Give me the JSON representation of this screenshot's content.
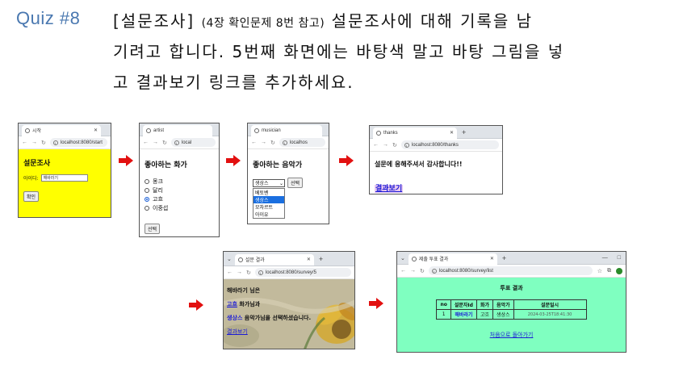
{
  "header": {
    "quiz_label": "Quiz #8",
    "line1_a": "[설문조사]",
    "line1_b": "(4장 확인문제 8번 참고)",
    "line1_c": "설문조사에 대해 기록을 남",
    "line2": "기려고 합니다. 5번째 화면에는 바탕색 말고 바탕 그림을 넣",
    "line3": "고 결과보기 링크를 추가하세요."
  },
  "screen1": {
    "tab_title": "시작",
    "url": "localhost:8080/start",
    "heading": "설문조사",
    "id_label": "아이디:",
    "id_value": "해바라기",
    "submit_label": "확인",
    "bg_color": "#ffff00"
  },
  "screen2": {
    "tab_title": "artist",
    "url": "local",
    "heading": "좋아하는 화가",
    "options": [
      "몽크",
      "달리",
      "고흐",
      "이중섭"
    ],
    "selected_index": 2,
    "submit_label": "선택"
  },
  "screen3": {
    "tab_title": "musician",
    "url": "localhos",
    "heading": "좋아하는 음악가",
    "select_value": "생상스",
    "submit_label": "선택",
    "dropdown_options": [
      "베토벤",
      "생상스",
      "모차르트",
      "아이유"
    ],
    "highlighted_index": 1
  },
  "screen4": {
    "tab_title": "thanks",
    "url": "localhost:8080/thanks",
    "message": "설문에 응해주셔서 감사합니다!!",
    "link_label": "결과보기"
  },
  "screen5": {
    "tab_title": "설문 결과",
    "url": "localhost:8080/survey/5",
    "line1_name": "해바라기",
    "line1_suffix": " 님은",
    "line2_artist": "고흐",
    "line2_suffix": " 화가님과",
    "line3_musician": "생상스",
    "line3_suffix": " 음악가님을 선택하셨습니다.",
    "link_label": "결과보기"
  },
  "screen6": {
    "tab_title": "제출 투표 결과",
    "url": "localhost:8080/survey/list",
    "heading": "투표 결과",
    "columns": [
      "no",
      "설문자Id",
      "화가",
      "음악가",
      "설문일시"
    ],
    "rows": [
      [
        "1",
        "해바라기",
        "고흐",
        "생상스",
        "2024-03-25T18:41:30"
      ]
    ],
    "footer_link": "처음으로 돌아가기",
    "bg_color": "#7fffc0",
    "window_min": "—",
    "window_max": "□"
  },
  "colors": {
    "arrow": "#e21010",
    "quiz_label": "#4a78b0"
  }
}
